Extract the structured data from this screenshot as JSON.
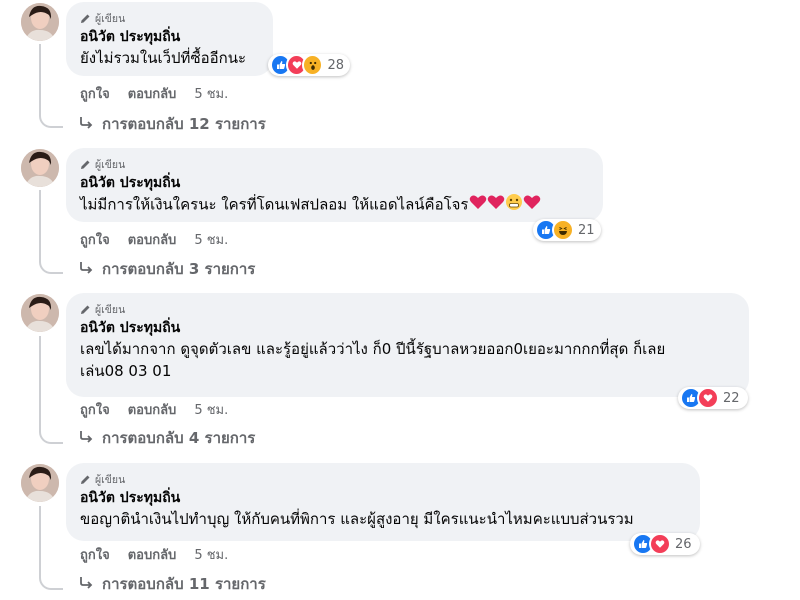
{
  "author_badge": "ผู้เขียน",
  "comments": [
    {
      "author": "อนิวัต ประทุมถิ่น",
      "text": "ยังไม่รวมในเว็ปที่ซื้ออีกนะ",
      "inline_emoji": [],
      "reactions": [
        "like",
        "love",
        "wow"
      ],
      "reaction_count": "28",
      "like_label": "ถูกใจ",
      "reply_label": "ตอบกลับ",
      "time": "5 ชม.",
      "replies_label": "การตอบกลับ 12 รายการ"
    },
    {
      "author": "อนิวัต ประทุมถิ่น",
      "text": "ไม่มีการให้เงินใครนะ ใครที่โดนเฟสปลอม ให้แอดไลน์คือโจร",
      "inline_emoji": [
        "heart",
        "heart",
        "grimace",
        "heart"
      ],
      "reactions": [
        "like",
        "haha"
      ],
      "reaction_count": "21",
      "like_label": "ถูกใจ",
      "reply_label": "ตอบกลับ",
      "time": "5 ชม.",
      "replies_label": "การตอบกลับ 3 รายการ"
    },
    {
      "author": "อนิวัต ประทุมถิ่น",
      "text": "เลขได้มากจาก ดูจุดตัวเลข และรู้อยู่แล้วว่าไง ก็0 ปีนี้รัฐบาลหวยออก0เยอะมากกกที่สุด ก็เลย\nเล่น08 03 01",
      "inline_emoji": [],
      "reactions": [
        "like",
        "love"
      ],
      "reaction_count": "22",
      "like_label": "ถูกใจ",
      "reply_label": "ตอบกลับ",
      "time": "5 ชม.",
      "replies_label": "การตอบกลับ 4 รายการ"
    },
    {
      "author": "อนิวัต ประทุมถิ่น",
      "text": "ขอญาตินำเงินไปทำบุญ ให้กับคนที่พิการ และผู้สูงอายุ มีใครแนะนำไหมคะแบบส่วนรวม",
      "inline_emoji": [],
      "reactions": [
        "like",
        "love"
      ],
      "reaction_count": "26",
      "like_label": "ถูกใจ",
      "reply_label": "ตอบกลับ",
      "time": "5 ชม.",
      "replies_label": "การตอบกลับ 11 รายการ"
    }
  ],
  "colors": {
    "like": "#1877f2",
    "love": "#f33e58",
    "wow": "#f7b125",
    "haha": "#f7b125",
    "bubble": "#f0f2f5",
    "secondary_text": "#65676b",
    "thread_line": "#ced0d4"
  }
}
